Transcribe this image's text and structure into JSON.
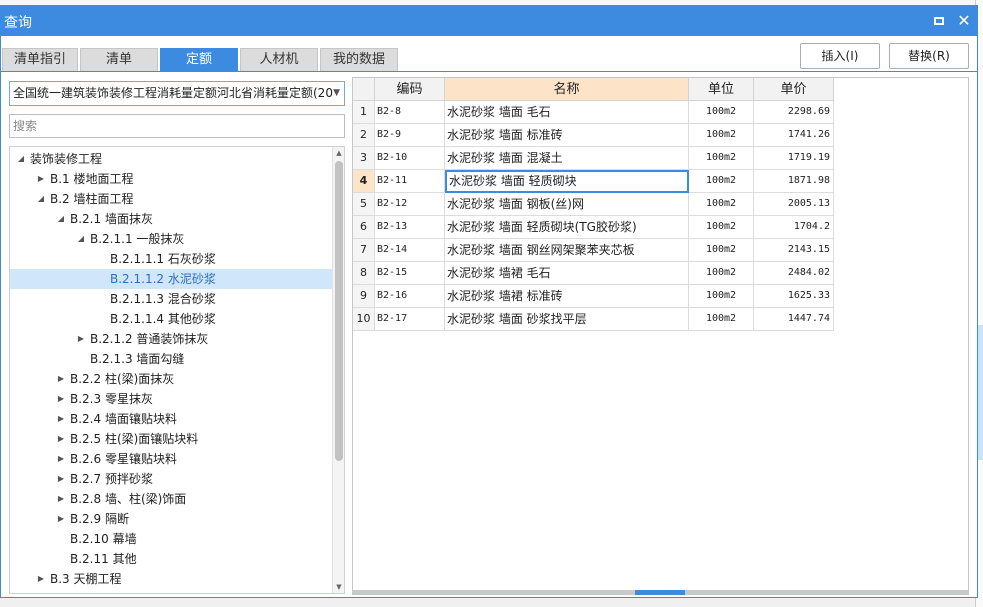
{
  "dialog": {
    "title": "查询"
  },
  "tabs": [
    {
      "label": "清单指引",
      "active": false
    },
    {
      "label": "清单",
      "active": false
    },
    {
      "label": "定额",
      "active": true
    },
    {
      "label": "人材机",
      "active": false
    },
    {
      "label": "我的数据",
      "active": false
    }
  ],
  "actions": {
    "insert": "插入(I)",
    "replace": "替换(R)"
  },
  "left": {
    "combo_value": "全国统一建筑装饰装修工程消耗量定额河北省消耗量定额(20",
    "search_placeholder": "搜索"
  },
  "tree": [
    {
      "label": "装饰装修工程",
      "level": 0,
      "toggle": "expanded",
      "selected": false
    },
    {
      "label": "B.1 楼地面工程",
      "level": 1,
      "toggle": "collapsed",
      "selected": false
    },
    {
      "label": "B.2 墙柱面工程",
      "level": 1,
      "toggle": "expanded",
      "selected": false
    },
    {
      "label": "B.2.1 墙面抹灰",
      "level": 2,
      "toggle": "expanded",
      "selected": false
    },
    {
      "label": "B.2.1.1 一般抹灰",
      "level": 3,
      "toggle": "expanded",
      "selected": false
    },
    {
      "label": "B.2.1.1.1 石灰砂浆",
      "level": 4,
      "toggle": "none",
      "selected": false
    },
    {
      "label": "B.2.1.1.2 水泥砂浆",
      "level": 4,
      "toggle": "none",
      "selected": true
    },
    {
      "label": "B.2.1.1.3 混合砂浆",
      "level": 4,
      "toggle": "none",
      "selected": false
    },
    {
      "label": "B.2.1.1.4 其他砂浆",
      "level": 4,
      "toggle": "none",
      "selected": false
    },
    {
      "label": "B.2.1.2 普通装饰抹灰",
      "level": 3,
      "toggle": "collapsed",
      "selected": false
    },
    {
      "label": "B.2.1.3 墙面勾缝",
      "level": 3,
      "toggle": "none",
      "selected": false
    },
    {
      "label": "B.2.2 柱(梁)面抹灰",
      "level": 2,
      "toggle": "collapsed",
      "selected": false
    },
    {
      "label": "B.2.3 零星抹灰",
      "level": 2,
      "toggle": "collapsed",
      "selected": false
    },
    {
      "label": "B.2.4 墙面镶贴块料",
      "level": 2,
      "toggle": "collapsed",
      "selected": false
    },
    {
      "label": "B.2.5 柱(梁)面镶贴块料",
      "level": 2,
      "toggle": "collapsed",
      "selected": false
    },
    {
      "label": "B.2.6 零星镶贴块料",
      "level": 2,
      "toggle": "collapsed",
      "selected": false
    },
    {
      "label": "B.2.7 预拌砂浆",
      "level": 2,
      "toggle": "collapsed",
      "selected": false
    },
    {
      "label": "B.2.8 墙、柱(梁)饰面",
      "level": 2,
      "toggle": "collapsed",
      "selected": false
    },
    {
      "label": "B.2.9 隔断",
      "level": 2,
      "toggle": "collapsed",
      "selected": false
    },
    {
      "label": "B.2.10 幕墙",
      "level": 2,
      "toggle": "none",
      "selected": false
    },
    {
      "label": "B.2.11 其他",
      "level": 2,
      "toggle": "none",
      "selected": false
    },
    {
      "label": "B.3 天棚工程",
      "level": 1,
      "toggle": "collapsed",
      "selected": false
    }
  ],
  "table": {
    "columns": [
      "编码",
      "名称",
      "单位",
      "单价"
    ],
    "current_row": 4,
    "rows": [
      {
        "idx": "1",
        "code": "B2-8",
        "name": "水泥砂浆 墙面 毛石",
        "unit": "100m2",
        "price": "2298.69"
      },
      {
        "idx": "2",
        "code": "B2-9",
        "name": "水泥砂浆 墙面 标准砖",
        "unit": "100m2",
        "price": "1741.26"
      },
      {
        "idx": "3",
        "code": "B2-10",
        "name": "水泥砂浆 墙面 混凝土",
        "unit": "100m2",
        "price": "1719.19"
      },
      {
        "idx": "4",
        "code": "B2-11",
        "name": "水泥砂浆 墙面 轻质砌块",
        "unit": "100m2",
        "price": "1871.98"
      },
      {
        "idx": "5",
        "code": "B2-12",
        "name": "水泥砂浆 墙面 钢板(丝)网",
        "unit": "100m2",
        "price": "2005.13"
      },
      {
        "idx": "6",
        "code": "B2-13",
        "name": "水泥砂浆 墙面 轻质砌块(TG胶砂浆)",
        "unit": "100m2",
        "price": "1704.2"
      },
      {
        "idx": "7",
        "code": "B2-14",
        "name": "水泥砂浆 墙面 钢丝网架聚苯夹芯板",
        "unit": "100m2",
        "price": "2143.15"
      },
      {
        "idx": "8",
        "code": "B2-15",
        "name": "水泥砂浆 墙裙 毛石",
        "unit": "100m2",
        "price": "2484.02"
      },
      {
        "idx": "9",
        "code": "B2-16",
        "name": "水泥砂浆 墙裙 标准砖",
        "unit": "100m2",
        "price": "1625.33"
      },
      {
        "idx": "10",
        "code": "B2-17",
        "name": "水泥砂浆 墙面 砂浆找平层",
        "unit": "100m2",
        "price": "1447.74"
      }
    ]
  },
  "colors": {
    "accent": "#3c8be0",
    "selected_row": "#cfe6fb",
    "header_highlight": "#fde3c7"
  }
}
